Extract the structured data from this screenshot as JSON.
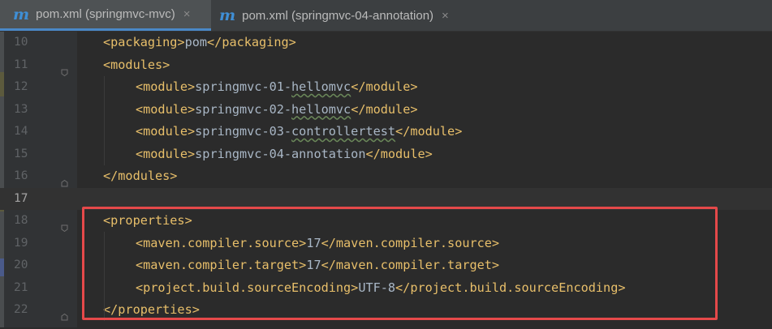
{
  "tabs": [
    {
      "icon": "maven-pom-icon",
      "label": "pom.xml (springmvc-mvc)",
      "active": true,
      "close": "×"
    },
    {
      "icon": "maven-pom-icon",
      "label": "pom.xml (springmvc-04-annotation)",
      "active": false,
      "close": "×"
    }
  ],
  "tab_icon_glyph": "m",
  "lines": [
    {
      "num": "10",
      "indent": 1,
      "open": "<packaging>",
      "text": "pom",
      "close": "</packaging>"
    },
    {
      "num": "11",
      "indent": 1,
      "open": "<modules>",
      "text": "",
      "close": ""
    },
    {
      "num": "12",
      "indent": 2,
      "open": "<module>",
      "text": "springmvc-01-",
      "underline": "hellomvc",
      "close": "</module>"
    },
    {
      "num": "13",
      "indent": 2,
      "open": "<module>",
      "text": "springmvc-02-",
      "underline": "hellomvc",
      "close": "</module>"
    },
    {
      "num": "14",
      "indent": 2,
      "open": "<module>",
      "text": "springmvc-03-",
      "underline": "controllertest",
      "close": "</module>"
    },
    {
      "num": "15",
      "indent": 2,
      "open": "<module>",
      "text": "springmvc-04-annotation",
      "close": "</module>"
    },
    {
      "num": "16",
      "indent": 1,
      "open": "</modules>",
      "text": "",
      "close": ""
    },
    {
      "num": "17",
      "indent": 0,
      "open": "",
      "text": "",
      "close": "",
      "current": true
    },
    {
      "num": "18",
      "indent": 1,
      "open": "<properties>",
      "text": "",
      "close": ""
    },
    {
      "num": "19",
      "indent": 2,
      "open": "<maven.compiler.source>",
      "text": "17",
      "close": "</maven.compiler.source>"
    },
    {
      "num": "20",
      "indent": 2,
      "open": "<maven.compiler.target>",
      "text": "17",
      "close": "</maven.compiler.target>"
    },
    {
      "num": "21",
      "indent": 2,
      "open": "<project.build.sourceEncoding>",
      "text": "UTF-8",
      "close": "</project.build.sourceEncoding>"
    },
    {
      "num": "22",
      "indent": 1,
      "open": "</properties>",
      "text": "",
      "close": ""
    }
  ],
  "colors": {
    "tag": "#e8bf6a",
    "text": "#a9b7c6",
    "highlight_box": "#e5494a",
    "tab_icon": "#3f8fd6"
  }
}
